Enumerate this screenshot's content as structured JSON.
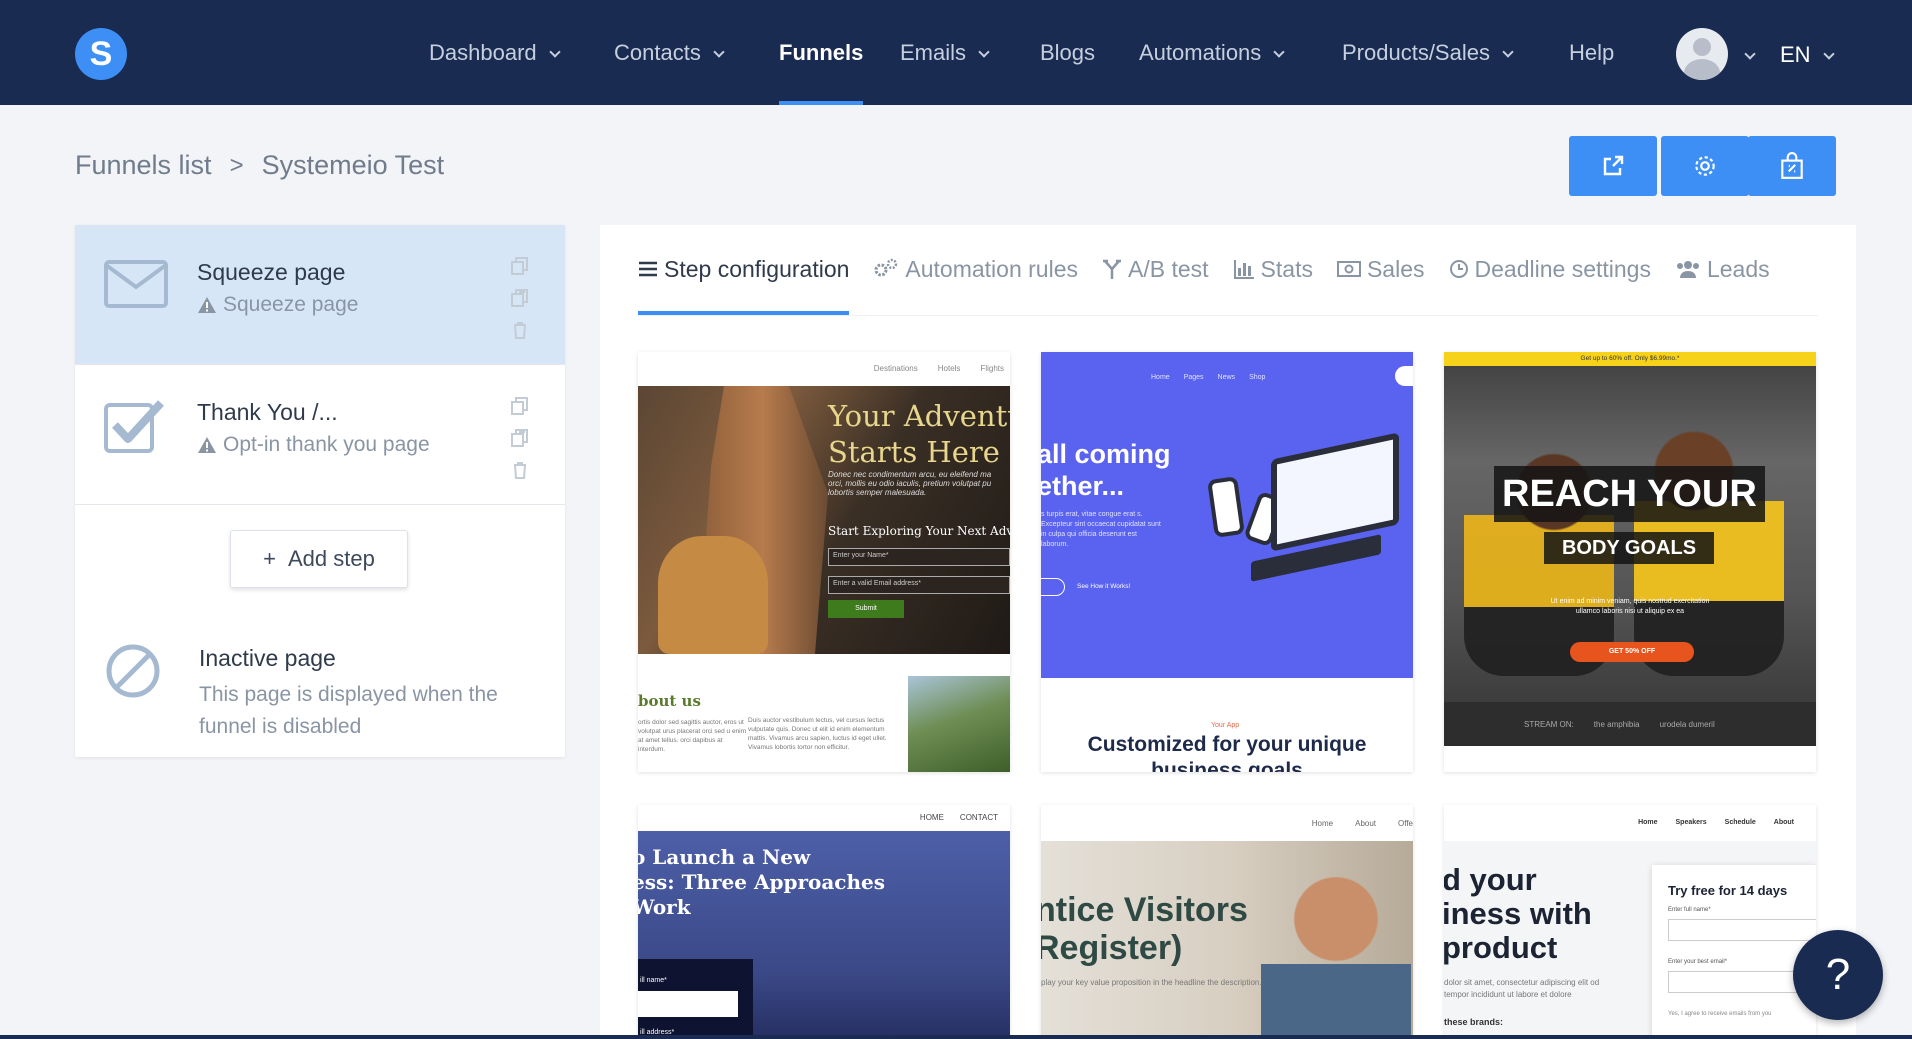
{
  "nav": {
    "logo": "S",
    "items": [
      {
        "label": "Dashboard",
        "dropdown": true
      },
      {
        "label": "Contacts",
        "dropdown": true
      },
      {
        "label": "Funnels",
        "dropdown": false,
        "active": true
      },
      {
        "label": "Emails",
        "dropdown": true
      },
      {
        "label": "Blogs",
        "dropdown": false
      },
      {
        "label": "Automations",
        "dropdown": true
      },
      {
        "label": "Products/Sales",
        "dropdown": true
      },
      {
        "label": "Help",
        "dropdown": false
      }
    ],
    "language": "EN"
  },
  "breadcrumb": {
    "root": "Funnels list",
    "separator": ">",
    "current": "Systemeio Test"
  },
  "toolbar": {
    "buttons": [
      "external-link-icon",
      "gear-icon",
      "marketplace-icon"
    ],
    "accent": "#3d8ff5"
  },
  "steps": [
    {
      "title": "Squeeze page",
      "subtitle": "Squeeze page",
      "icon": "envelope-icon",
      "active": true
    },
    {
      "title": "Thank You /...",
      "subtitle": "Opt-in thank you page",
      "icon": "checkbox-icon",
      "active": false
    }
  ],
  "add_step": {
    "plus": "+",
    "label": "Add step"
  },
  "inactive": {
    "title": "Inactive page",
    "description": "This page is displayed when the funnel is disabled"
  },
  "tabs": [
    {
      "label": "Step configuration",
      "icon": "list-icon",
      "active": true
    },
    {
      "label": "Automation rules",
      "icon": "gears-icon"
    },
    {
      "label": "A/B test",
      "icon": "split-icon"
    },
    {
      "label": "Stats",
      "icon": "bar-chart-icon"
    },
    {
      "label": "Sales",
      "icon": "money-icon"
    },
    {
      "label": "Deadline settings",
      "icon": "clock-icon"
    },
    {
      "label": "Leads",
      "icon": "users-icon"
    }
  ],
  "templates": {
    "t1": {
      "nav": [
        "Destinations",
        "Hotels",
        "Flights"
      ],
      "title_line1": "Your Adventu",
      "title_line2": "Starts Here",
      "para": "Donec nec condimentum arcu, eu eleifend ma orci, mollis eu odio iaculis, pretium volutpat pu lobortis semper malesuada.",
      "subhead": "Start Exploring Your Next Adve",
      "name_placeholder": "Enter your Name*",
      "email_placeholder": "Enter a valid Email address*",
      "submit": "Submit",
      "about": "bout us",
      "col1": "ortis dolor sed sagittis auctor, eros ut volutpat urus placerat orci sed u enim at amet tellus. orci dapibus at interdum.",
      "col2": "Duis auctor vestibulum lectus, vel cursus lectus vulputate quis. Donec ut elit id enim elementum mattis. Vivamus arcu sapien, luctus id eget ullet. Vivamus lobortis tortor non efficitur."
    },
    "t2": {
      "nav": [
        "Home",
        "Pages",
        "News",
        "Shop"
      ],
      "title_line1": "all coming",
      "title_line2": "ether...",
      "para": "s turpis erat, vitae congue erat s. Excepteur sint occaecat cupidatat sunt in culpa qui officia deserunt est laborum.",
      "link": "See How it Works!",
      "label": "Your App",
      "headline": "Customized for your unique business goals"
    },
    "t3": {
      "bar": "Get up to 60% off. Only $6.99mo.*",
      "reach": "REACH YOUR",
      "goals": "BODY GOALS",
      "para": "Ut enim ad minim veniam, quis nostrud exercitation ullamco laboris nisi ut aliquip ex ea",
      "cta": "GET 50% OFF",
      "strip": [
        "STREAM ON:",
        "the amphibia",
        "urodela dumeril"
      ]
    },
    "t4": {
      "nav": [
        "HOME",
        "CONTACT"
      ],
      "title_line1": "o Launch a New",
      "title_line2": "ess: Three Approaches",
      "title_line3": "Work",
      "name_label": "ill name*",
      "email_label": "ill address*"
    },
    "t5": {
      "nav": [
        "Home",
        "About",
        "Offe"
      ],
      "title_line1": "ntice Visitors",
      "title_line2": "Register)",
      "para": "play your key value proposition in the headline the description."
    },
    "t6": {
      "nav": [
        "Home",
        "Speakers",
        "Schedule",
        "About"
      ],
      "title_line1": "d your",
      "title_line2": "iness with",
      "title_line3": "product",
      "para": "dolor sit amet, consectetur adipiscing elit od tempor incididunt ut labore et dolore",
      "brands": "these brands:",
      "card_title": "Try free for 14 days",
      "name_label": "Enter full name*",
      "email_label": "Enter your best email*",
      "consent": "Yes, I agree to receive emails from you"
    }
  },
  "help_button": "?"
}
